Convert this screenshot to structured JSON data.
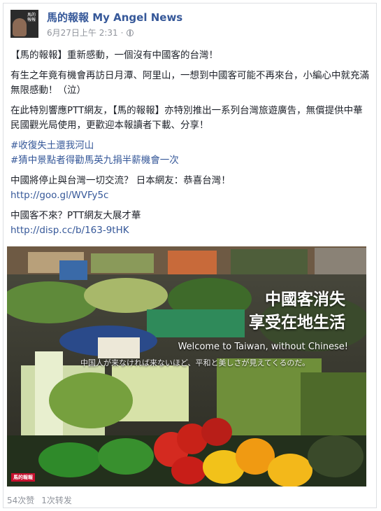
{
  "post": {
    "page_name": "馬的報報 My Angel News",
    "timestamp": "6月27日上午 2:31",
    "avatar_text": "馬的報報",
    "paragraphs": {
      "p1": "【馬的報報】重新感動，一個沒有中國客的台灣！",
      "p2": "有生之年竟有機會再訪日月潭、阿里山，一想到中國客可能不再來台，小編心中就充滿無限感動！（泣）",
      "p3": "在此特別響應PTT網友，【馬的報報】亦特別推出一系列台灣旅遊廣告，無償提供中華民國觀光局使用，更歡迎本報讀者下載、分享！"
    },
    "hashtags": [
      "#收復失土還我河山",
      "#猜中景點者得勸馬英九捐半薪機會一次"
    ],
    "news1": {
      "title": "中國將停止與台灣一切交流？ 日本網友：恭喜台灣！",
      "url": "http://goo.gl/WVFy5c"
    },
    "news2": {
      "title": "中國客不來？PTT網友大展才華",
      "url": "http://disp.cc/b/163-9tHK"
    },
    "image": {
      "headline_line1": "中國客消失",
      "headline_line2": "享受在地生活",
      "english": "Welcome to Taiwan, without Chinese!",
      "japanese": "中国人が来なければ来ないほど、平和と美しさが見えてくるのだ。",
      "stamp": "馬的報報"
    },
    "stats": {
      "likes": "54次赞",
      "shares": "1次转发"
    }
  },
  "colors": {
    "link": "#365899",
    "meta": "#90949c",
    "text": "#1d2129"
  }
}
